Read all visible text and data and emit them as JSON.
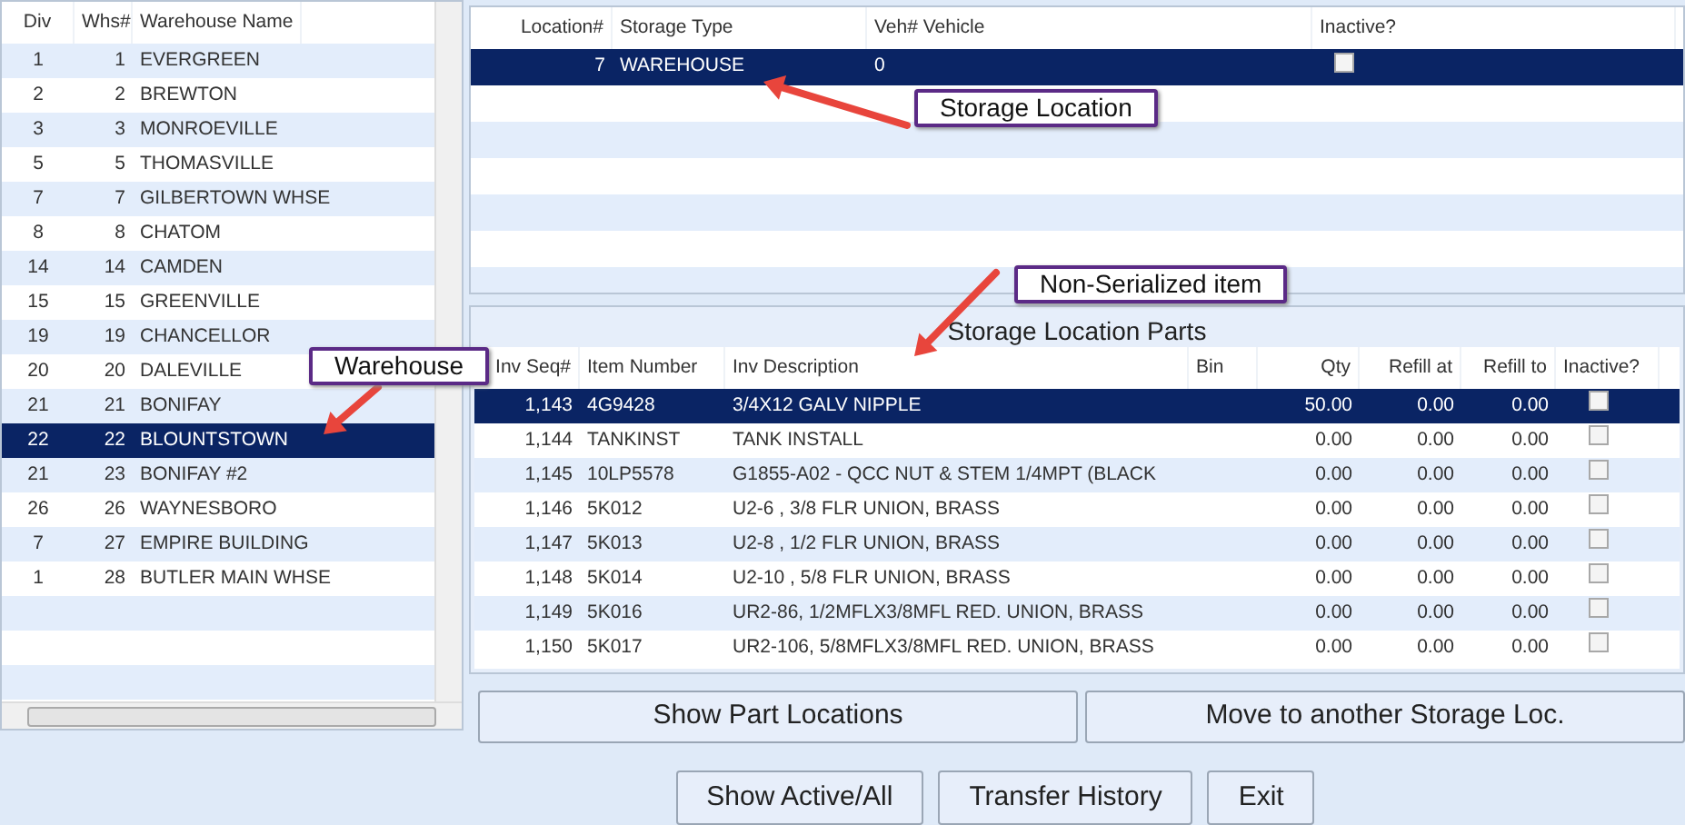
{
  "warehouses": {
    "columns": [
      "Div",
      "Whs#",
      "Warehouse Name"
    ],
    "rows": [
      {
        "div": "1",
        "whs": "1",
        "name": "EVERGREEN",
        "selected": false
      },
      {
        "div": "2",
        "whs": "2",
        "name": "BREWTON",
        "selected": false
      },
      {
        "div": "3",
        "whs": "3",
        "name": "MONROEVILLE",
        "selected": false
      },
      {
        "div": "5",
        "whs": "5",
        "name": "THOMASVILLE",
        "selected": false
      },
      {
        "div": "7",
        "whs": "7",
        "name": "GILBERTOWN WHSE",
        "selected": false
      },
      {
        "div": "8",
        "whs": "8",
        "name": "CHATOM",
        "selected": false
      },
      {
        "div": "14",
        "whs": "14",
        "name": "CAMDEN",
        "selected": false
      },
      {
        "div": "15",
        "whs": "15",
        "name": "GREENVILLE",
        "selected": false
      },
      {
        "div": "19",
        "whs": "19",
        "name": "CHANCELLOR",
        "selected": false
      },
      {
        "div": "20",
        "whs": "20",
        "name": "DALEVILLE",
        "selected": false
      },
      {
        "div": "21",
        "whs": "21",
        "name": "BONIFAY",
        "selected": false
      },
      {
        "div": "22",
        "whs": "22",
        "name": "BLOUNTSTOWN",
        "selected": true
      },
      {
        "div": "21",
        "whs": "23",
        "name": "BONIFAY #2",
        "selected": false
      },
      {
        "div": "26",
        "whs": "26",
        "name": "WAYNESBORO",
        "selected": false
      },
      {
        "div": "7",
        "whs": "27",
        "name": "EMPIRE BUILDING",
        "selected": false
      },
      {
        "div": "1",
        "whs": "28",
        "name": "BUTLER MAIN WHSE",
        "selected": false
      }
    ]
  },
  "storage_locations": {
    "columns": [
      "Location#",
      "Storage Type",
      "Veh# Vehicle",
      "Inactive?"
    ],
    "rows": [
      {
        "location": "7",
        "storage_type": "WAREHOUSE",
        "vehicle": "0",
        "inactive": false,
        "selected": true
      }
    ]
  },
  "parts": {
    "title": "Storage Location Parts",
    "columns": [
      "Inv Seq#",
      "Item Number",
      "Inv Description",
      "Bin",
      "Qty",
      "Refill at",
      "Refill to",
      "Inactive?"
    ],
    "rows": [
      {
        "inv_seq": "1,143",
        "item_number": "4G9428",
        "description": "3/4X12 GALV NIPPLE",
        "qty": "50.00",
        "refill_at": "0.00",
        "refill_to": "0.00",
        "inactive": false,
        "selected": true
      },
      {
        "inv_seq": "1,144",
        "item_number": "TANKINST",
        "description": "TANK INSTALL",
        "qty": "0.00",
        "refill_at": "0.00",
        "refill_to": "0.00",
        "inactive": false,
        "selected": false
      },
      {
        "inv_seq": "1,145",
        "item_number": "10LP5578",
        "description": "G1855-A02 - QCC NUT & STEM 1/4MPT (BLACK",
        "qty": "0.00",
        "refill_at": "0.00",
        "refill_to": "0.00",
        "inactive": false,
        "selected": false
      },
      {
        "inv_seq": "1,146",
        "item_number": "5K012",
        "description": "U2-6 , 3/8 FLR UNION, BRASS",
        "qty": "0.00",
        "refill_at": "0.00",
        "refill_to": "0.00",
        "inactive": false,
        "selected": false
      },
      {
        "inv_seq": "1,147",
        "item_number": "5K013",
        "description": "U2-8 , 1/2 FLR UNION, BRASS",
        "qty": "0.00",
        "refill_at": "0.00",
        "refill_to": "0.00",
        "inactive": false,
        "selected": false
      },
      {
        "inv_seq": "1,148",
        "item_number": "5K014",
        "description": "U2-10 , 5/8 FLR UNION, BRASS",
        "qty": "0.00",
        "refill_at": "0.00",
        "refill_to": "0.00",
        "inactive": false,
        "selected": false
      },
      {
        "inv_seq": "1,149",
        "item_number": "5K016",
        "description": "UR2-86, 1/2MFLX3/8MFL RED. UNION, BRASS",
        "qty": "0.00",
        "refill_at": "0.00",
        "refill_to": "0.00",
        "inactive": false,
        "selected": false
      },
      {
        "inv_seq": "1,150",
        "item_number": "5K017",
        "description": "UR2-106, 5/8MFLX3/8MFL RED. UNION, BRASS",
        "qty": "0.00",
        "refill_at": "0.00",
        "refill_to": "0.00",
        "inactive": false,
        "selected": false
      }
    ]
  },
  "part_buttons": [
    "Show Part Locations",
    "Move to another Storage Loc."
  ],
  "bottom_buttons": [
    "Show Active/All",
    "Transfer History",
    "Exit"
  ],
  "callouts": [
    {
      "kind": "warehouse",
      "text": "Warehouse"
    },
    {
      "kind": "storage",
      "text": "Storage Location"
    },
    {
      "kind": "item",
      "text": "Non-Serialized item"
    }
  ]
}
